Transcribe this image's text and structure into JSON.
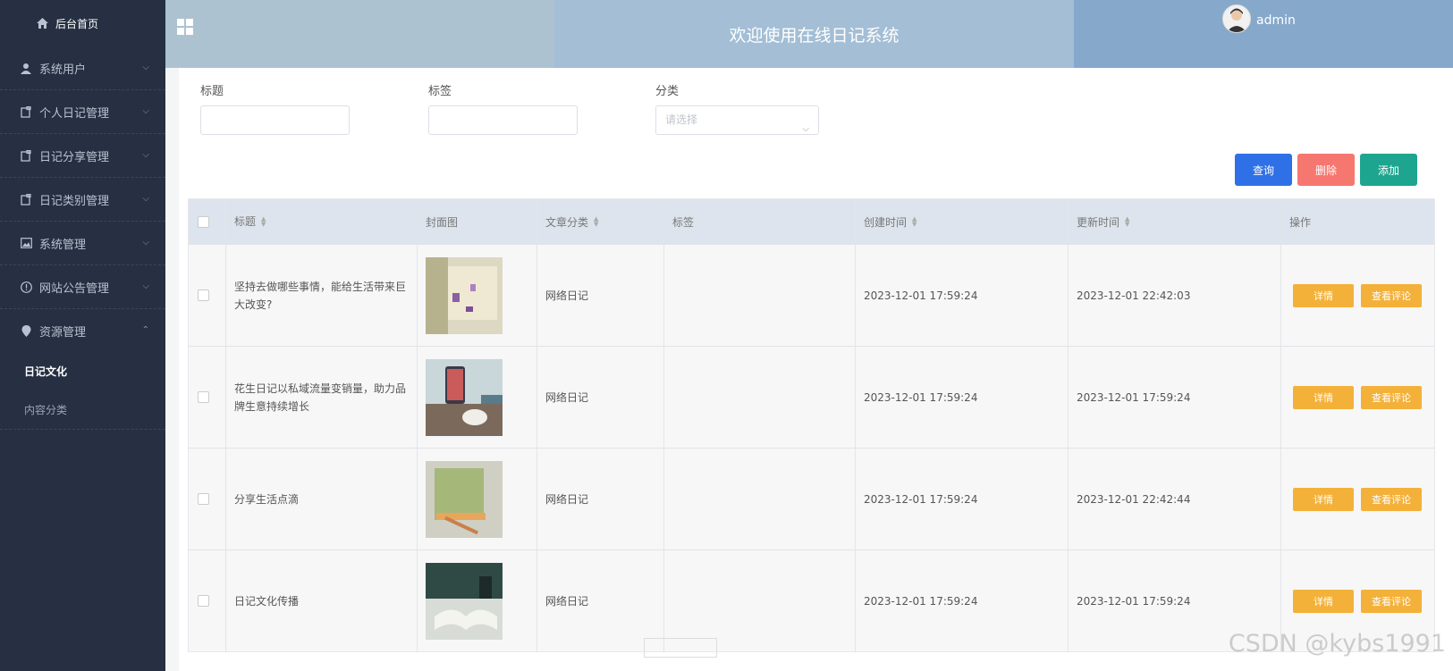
{
  "sidebar": {
    "home": "后台首页",
    "items": [
      {
        "label": "系统用户",
        "icon": "user-icon"
      },
      {
        "label": "个人日记管理",
        "icon": "document-icon"
      },
      {
        "label": "日记分享管理",
        "icon": "document-icon"
      },
      {
        "label": "日记类别管理",
        "icon": "document-icon"
      },
      {
        "label": "系统管理",
        "icon": "image-icon"
      },
      {
        "label": "网站公告管理",
        "icon": "info-icon"
      },
      {
        "label": "资源管理",
        "icon": "location-icon"
      }
    ],
    "sub_items": [
      {
        "label": "日记文化",
        "active": true
      },
      {
        "label": "内容分类",
        "active": false
      }
    ]
  },
  "header": {
    "title": "欢迎使用在线日记系统",
    "user": "admin"
  },
  "search": {
    "title_label": "标题",
    "tag_label": "标签",
    "category_label": "分类",
    "category_placeholder": "请选择"
  },
  "buttons": {
    "query": "查询",
    "delete": "删除",
    "add": "添加"
  },
  "table": {
    "headers": [
      "标题",
      "封面图",
      "文章分类",
      "标签",
      "创建时间",
      "更新时间",
      "操作"
    ],
    "rows": [
      {
        "title": "坚持去做哪些事情，能给生活带来巨大改变?",
        "category": "网络日记",
        "tag": "",
        "created": "2023-12-01 17:59:24",
        "updated": "2023-12-01 22:42:03"
      },
      {
        "title": "花生日记以私域流量变销量，助力品牌生意持续增长",
        "category": "网络日记",
        "tag": "",
        "created": "2023-12-01 17:59:24",
        "updated": "2023-12-01 17:59:24"
      },
      {
        "title": "分享生活点滴",
        "category": "网络日记",
        "tag": "",
        "created": "2023-12-01 17:59:24",
        "updated": "2023-12-01 22:42:44"
      },
      {
        "title": "日记文化传播",
        "category": "网络日记",
        "tag": "",
        "created": "2023-12-01 17:59:24",
        "updated": "2023-12-01 17:59:24"
      }
    ],
    "detail_label": "详情",
    "comment_label": "查看评论"
  },
  "watermark": "CSDN @kybs1991"
}
